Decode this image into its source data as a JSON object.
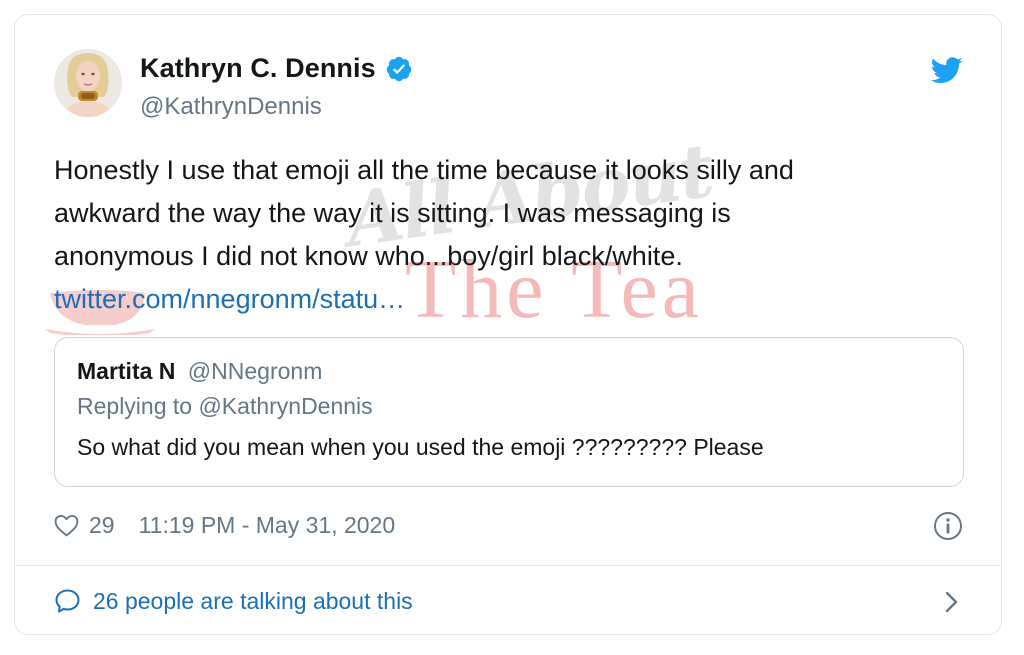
{
  "author": {
    "display_name": "Kathryn C. Dennis",
    "handle": "@KathrynDennis",
    "verified": true,
    "verified_icon": "verified-badge-icon",
    "avatar_icon": "avatar"
  },
  "brand": {
    "logo_icon": "twitter-bird-icon",
    "accent_color": "#1da1f2",
    "link_color": "#1b6fb5"
  },
  "tweet": {
    "lines": [
      "Honestly I use that emoji all the time because it looks silly and",
      "awkward the way the way it is sitting. I was messaging is",
      "anonymous I did not  know who...boy/girl black/white."
    ],
    "link": "twitter.com/nnegronm/statu…"
  },
  "watermark": {
    "script": "All About",
    "word": "The Tea"
  },
  "quoted_tweet": {
    "name": "Martita N",
    "handle": "@NNegronm",
    "replying_to": "Replying to @KathrynDennis",
    "text": "So what did you mean when you used the emoji ????????? Please"
  },
  "meta": {
    "likes": "29",
    "timestamp": "11:19 PM - May 31, 2020",
    "like_icon": "heart-icon",
    "info_icon": "info-icon"
  },
  "footer": {
    "conversation_text": "26 people are talking about this",
    "bubble_icon": "speech-bubble-icon",
    "chevron_icon": "chevron-right-icon"
  }
}
